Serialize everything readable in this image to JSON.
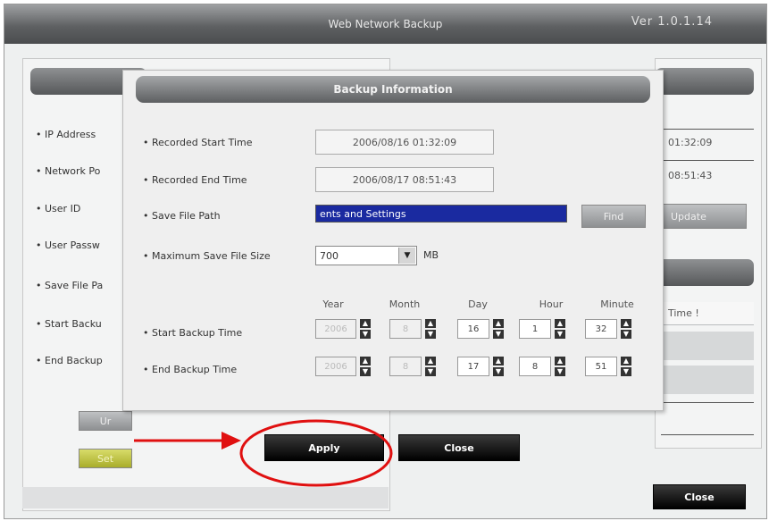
{
  "window": {
    "title": "Web Network Backup",
    "version": "Ver 1.0.1.14"
  },
  "left_panel": {
    "items": [
      "IP Address",
      "Network Po",
      "User ID",
      "User Passw",
      "Save File Pa",
      "Start Backu",
      "End Backup"
    ],
    "btn1": "Ur",
    "btn2": "Set"
  },
  "right_panel": {
    "start_value": "01:32:09",
    "end_value": "08:51:43",
    "update_label": "Update",
    "time_label": "Time !"
  },
  "dialog": {
    "title": "Backup Information",
    "recorded_start_label": "Recorded Start Time",
    "recorded_start_value": "2006/08/16 01:32:09",
    "recorded_end_label": "Recorded End Time",
    "recorded_end_value": "2006/08/17 08:51:43",
    "save_path_label": "Save File Path",
    "save_path_value": "ents and Settings",
    "find_label": "Find",
    "max_size_label": "Maximum Save File Size",
    "max_size_value": "700",
    "max_size_unit": "MB",
    "col_year": "Year",
    "col_month": "Month",
    "col_day": "Day",
    "col_hour": "Hour",
    "col_minute": "Minute",
    "start_backup_label": "Start Backup Time",
    "end_backup_label": "End Backup Time",
    "start": {
      "year": "2006",
      "month": "8",
      "day": "16",
      "hour": "1",
      "minute": "32"
    },
    "end": {
      "year": "2006",
      "month": "8",
      "day": "17",
      "hour": "8",
      "minute": "51"
    },
    "apply_label": "Apply",
    "close_label": "Close"
  },
  "main_close_label": "Close",
  "colors": {
    "annotation": "#e01010",
    "path_highlight": "#1a2aa0"
  }
}
